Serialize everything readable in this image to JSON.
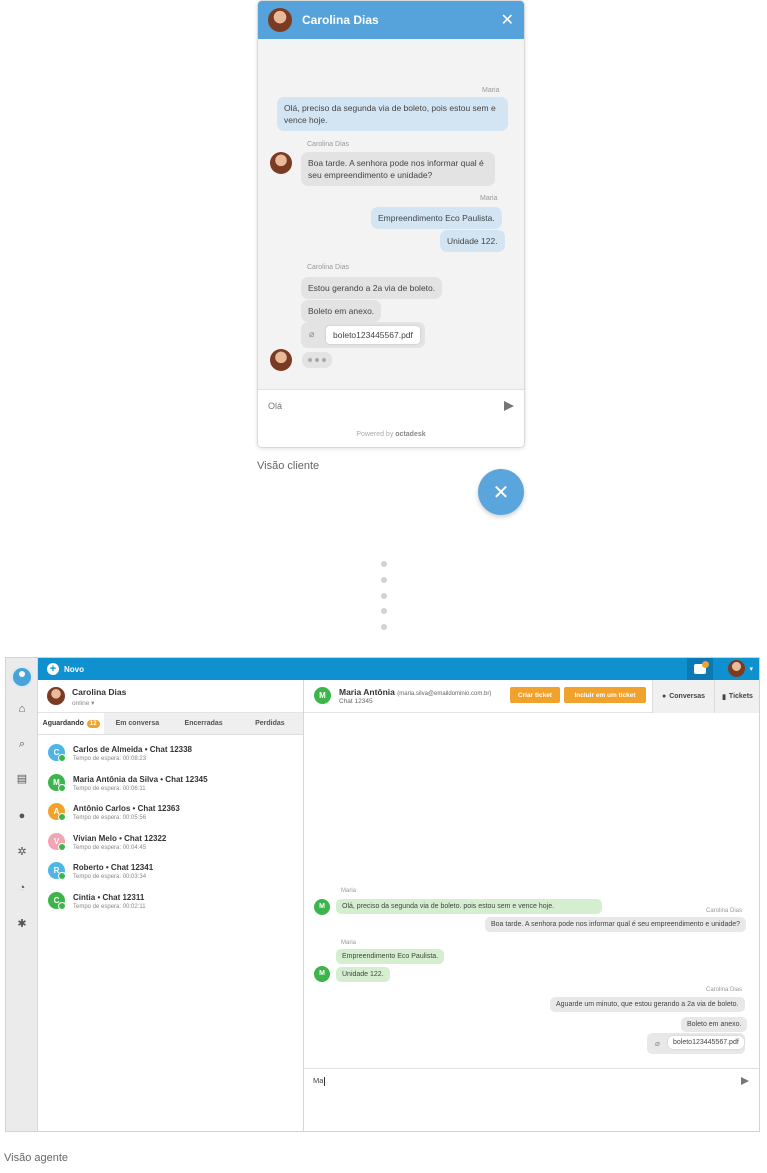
{
  "client_widget": {
    "contact_name": "Carolina Dias",
    "messages": {
      "sender_maria_1": "Maria",
      "msg_1": "Olá, preciso da segunda via de boleto, pois estou sem e vence hoje.",
      "sender_carolina_1": "Carolina Dias",
      "msg_2": "Boa tarde. A senhora pode nos informar qual é seu empreendimento e unidade?",
      "sender_maria_2": "Maria",
      "msg_3": "Empreendimento Eco Paulista.",
      "msg_4": "Unidade 122.",
      "sender_carolina_2": "Carolina Dias",
      "msg_5": "Estou gerando a 2a via de boleto.",
      "msg_6": "Boleto em anexo.",
      "attachment": "boleto123445567.pdf"
    },
    "input_value": "Olá",
    "powered_by": "Powered by",
    "powered_brand": "octadesk"
  },
  "captions": {
    "client_view": "Visão cliente",
    "agent_view": "Visão agente"
  },
  "agent_app": {
    "topbar": {
      "new_label": "Novo"
    },
    "agent": {
      "name": "Carolina Dias",
      "status": "online"
    },
    "tabs": [
      {
        "label": "Aguardando",
        "count": "12"
      },
      {
        "label": "Em conversa"
      },
      {
        "label": "Encerradas"
      },
      {
        "label": "Perdidas"
      }
    ],
    "queue": [
      {
        "initial": "C",
        "title": "Carlos de Almeida • Chat 12338",
        "wait": "Tempo de espera: 00:08:23",
        "color": "#4db6e8"
      },
      {
        "initial": "M",
        "title": "Maria Antônia da Silva • Chat 12345",
        "wait": "Tempo de espera: 00:06:11",
        "color": "#3cb64a"
      },
      {
        "initial": "A",
        "title": "Antônio Carlos • Chat 12363",
        "wait": "Tempo de espera: 00:05:56",
        "color": "#f1a22c"
      },
      {
        "initial": "V",
        "title": "Vivian Melo • Chat 12322",
        "wait": "Tempo de espera: 00:04:45",
        "color": "#f4a3b0"
      },
      {
        "initial": "R",
        "title": "Roberto • Chat 12341",
        "wait": "Tempo de espera: 00:03:34",
        "color": "#4db6e8"
      },
      {
        "initial": "C",
        "title": "Cintia • Chat 12311",
        "wait": "Tempo de espera: 00:02:11",
        "color": "#3cb64a"
      }
    ],
    "conversation": {
      "customer_initial": "M",
      "customer_name": "Maria Antônia",
      "customer_email": "(maria.silva@emaildominio.com.br)",
      "chat_id": "Chat 12345",
      "create_ticket": "Criar ticket",
      "include_ticket": "Incluir em um ticket",
      "tab_conversations": "Conversas",
      "tab_tickets": "Tickets",
      "sender_maria_1": "Maria",
      "msg_1": "Olá, preciso da segunda via de boleto. pois estou sem e vence hoje.",
      "sender_carolina_1": "Carolina Dias",
      "msg_2": "Boa tarde. A senhora pode nos informar qual é seu empreendimento e unidade?",
      "sender_maria_2": "Maria",
      "msg_3": "Empreendimento Eco Paulista.",
      "msg_4": "Unidade 122.",
      "sender_carolina_2": "Carolina Dias",
      "msg_5": "Aguarde um minuto, que estou gerando a 2a via de boleto.",
      "msg_6": "Boleto em anexo.",
      "attachment": "boleto123445567.pdf",
      "input_value": "Ma"
    }
  },
  "colors": {
    "widget_header": "#55a3da",
    "agent_topbar": "#0f91d0",
    "accent_orange": "#f1a22c",
    "online_green": "#3cb64a"
  },
  "icons": [
    "close-icon",
    "send-icon",
    "paperclip-icon",
    "home-icon",
    "search-icon",
    "list-icon",
    "user-icon",
    "puzzle-icon",
    "pie-chart-icon",
    "gear-icon",
    "chat-bubble-icon",
    "ticket-icon",
    "plus-icon"
  ]
}
